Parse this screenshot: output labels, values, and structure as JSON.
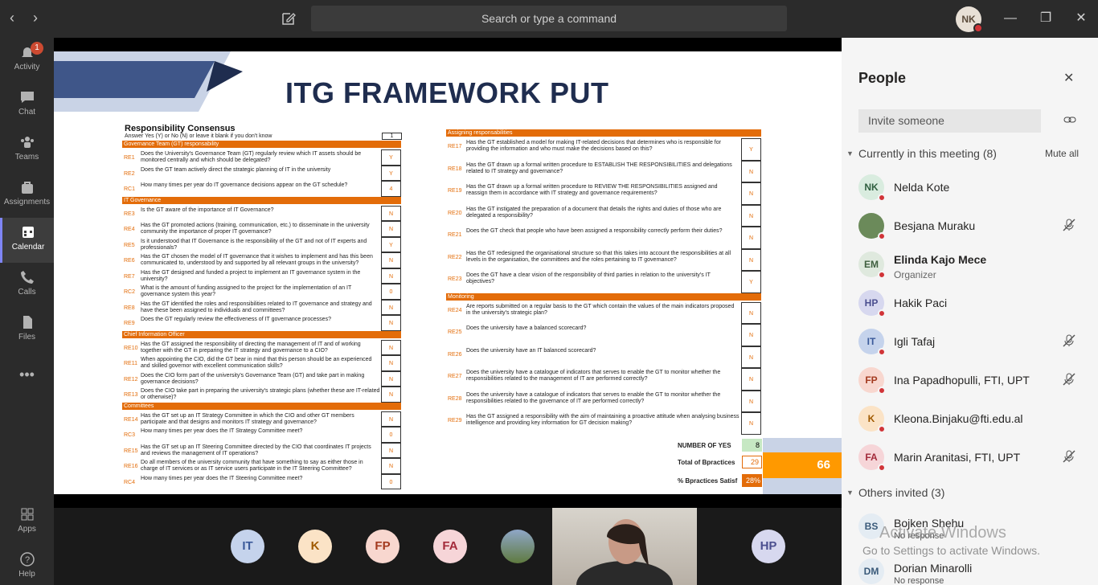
{
  "search": {
    "placeholder": "Search or type a command"
  },
  "me": {
    "initials": "NK"
  },
  "rail": [
    {
      "label": "Activity",
      "badge": "1"
    },
    {
      "label": "Chat"
    },
    {
      "label": "Teams"
    },
    {
      "label": "Assignments"
    },
    {
      "label": "Calendar"
    },
    {
      "label": "Calls"
    },
    {
      "label": "Files"
    },
    {
      "label": "Apps"
    },
    {
      "label": "Help"
    }
  ],
  "slide": {
    "title": "ITG FRAMEWORK PUT",
    "heading": "Responsibility Consensus",
    "instruction": "Answer Yes (Y) or No (N) or leave it blank if you don't know",
    "instruction_value": "1",
    "left_sections": [
      {
        "title": "Governance Team (GT) responsability",
        "items": [
          {
            "code": "RE1",
            "text": "Does the University's Governance Team (GT) regularly review which IT assets should be monitored centrally and which should be delegated?",
            "answer": "Y"
          },
          {
            "code": "RE2",
            "text": "Does the GT team actively direct the strategic planning of IT in the university",
            "answer": "Y"
          },
          {
            "code": "RC1",
            "text": "How many times per year do IT governance decisions appear on the GT schedule?",
            "answer": "4"
          }
        ]
      },
      {
        "title": "IT Governance",
        "items": [
          {
            "code": "RE3",
            "text": "Is the GT aware of the importance of IT Governance?",
            "answer": "N"
          },
          {
            "code": "RE4",
            "text": "Has the GT promoted actions (training, communication, etc.) to disseminate in the university community the importance of proper IT governance?",
            "answer": "N"
          },
          {
            "code": "RE5",
            "text": "Is it understood that IT Governance is the responsibility of the GT and not of IT experts and professionals?",
            "answer": "Y"
          },
          {
            "code": "RE6",
            "text": "Has the GT chosen the model of IT governance that it wishes to implement and has this been communicated to, understood by and supported by all relevant groups in the university?",
            "answer": "N"
          },
          {
            "code": "RE7",
            "text": "Has the GT designed and funded a project to implement an IT governance system in the university?",
            "answer": "N"
          },
          {
            "code": "RC2",
            "text": "What is the amount of funding assigned to the project for the implementation of an IT governance system this year?",
            "answer": "0"
          },
          {
            "code": "RE8",
            "text": "Has the GT identified the roles and responsibilities related to IT governance and strategy and have these been assigned to individuals and committees?",
            "answer": "N"
          },
          {
            "code": "RE9",
            "text": "Does the GT regularly review the effectiveness of IT governance processes?",
            "answer": "N"
          }
        ]
      },
      {
        "title": "Chief Information Officer",
        "items": [
          {
            "code": "RE10",
            "text": "Has the GT assigned the responsibility of directing the management of IT and of working together with the GT in preparing the IT strategy and governance to a CIO?",
            "answer": "N"
          },
          {
            "code": "RE11",
            "text": "When appointing the CIO, did the GT bear in mind that this person should be an experienced and skilled governor with excellent communication skills?",
            "answer": "N"
          },
          {
            "code": "RE12",
            "text": "Does the CIO form part of the university's Governance Team (GT) and take part in making governance decisions?",
            "answer": "N"
          },
          {
            "code": "RE13",
            "text": "Does the CIO take part in preparing the university's strategic plans (whether these are IT-related or otherwise)?",
            "answer": "N"
          }
        ]
      },
      {
        "title": "Committees",
        "items": [
          {
            "code": "RE14",
            "text": "Has the GT set up an IT Strategy Committee in which the CIO and other GT members participate and that designs and monitors IT strategy and governance?",
            "answer": "N"
          },
          {
            "code": "RC3",
            "text": "How many times per year does the IT Strategy Committee meet?",
            "answer": "0"
          },
          {
            "code": "RE15",
            "text": "Has the GT set up an IT Steering Committee directed by the CIO that coordinates IT projects and reviews the management of IT operations?",
            "answer": "N"
          },
          {
            "code": "RE16",
            "text": "Do all members of the university community that have something to say as either those in charge of IT services or as IT service users participate in the IT Steering Committee?",
            "answer": "N"
          },
          {
            "code": "RC4",
            "text": "How many times per year does the IT Steering Committee meet?",
            "answer": "0"
          }
        ]
      }
    ],
    "right_sections": [
      {
        "title": "Assigning responsabilities",
        "items": [
          {
            "code": "RE17",
            "text": "Has the GT established a model for making IT-related decisions that determines who is responsible for providing the information and who must make the decisions based on this?",
            "answer": "Y"
          },
          {
            "code": "RE18",
            "text": "Has the GT drawn up a formal written procedure to ESTABLISH THE RESPONSIBILITIES and delegations related to IT strategy and governance?",
            "answer": "N"
          },
          {
            "code": "RE19",
            "text": "Has the GT drawn up a formal written procedure to REVIEW THE RESPONSIBILITIES assigned and reassign them in accordance with IT strategy and governance requirements?",
            "answer": "N"
          },
          {
            "code": "RE20",
            "text": "Has the GT instigated the preparation of a document that details the rights and duties of those who are delegated a responsibility?",
            "answer": "N"
          },
          {
            "code": "RE21",
            "text": "Does the GT check that people who have been assigned a responsibility correctly perform their duties?",
            "answer": "N"
          },
          {
            "code": "RE22",
            "text": "Has the GT redesigned the organisational structure so that this takes into account the responsibilities at all levels in the organisation, the committees and the roles pertaining to IT governance?",
            "answer": "N"
          },
          {
            "code": "RE23",
            "text": "Does the GT have a clear vision of the responsibility of third parties in relation to the university's IT objectives?",
            "answer": "Y"
          }
        ]
      },
      {
        "title": "Monitoring",
        "items": [
          {
            "code": "RE24",
            "text": "Are reports submitted on a regular basis to the GT which contain the values of the main indicators proposed in the university's strategic plan?",
            "answer": "N"
          },
          {
            "code": "RE25",
            "text": "Does the university have a balanced scorecard?",
            "answer": "N"
          },
          {
            "code": "RE26",
            "text": "Does the university have an IT balanced scorecard?",
            "answer": "N"
          },
          {
            "code": "RE27",
            "text": "Does the university have a catalogue of indicators that serves to enable the GT to monitor whether the responsibilities related to the management of IT are performed correctly?",
            "answer": "N"
          },
          {
            "code": "RE28",
            "text": "Does the university have a catalogue of indicators that serves to enable the GT to monitor whether the responsibilities related to the governance of IT are performed correctly?",
            "answer": "N"
          },
          {
            "code": "RE29",
            "text": "Has the GT assigned a responsibility with the aim of maintaining a proactive attitude when analysing business intelligence and providing key information for GT decision making?",
            "answer": "N"
          }
        ]
      }
    ],
    "summary": {
      "yes_label": "NUMBER OF YES",
      "yes_value": "8",
      "total_label": "Total of Bpractices",
      "total_value": "29",
      "pct_label": "% Bpractices Satisf",
      "pct_value": "28%",
      "score": "66"
    }
  },
  "strip": [
    {
      "initials": "IT",
      "bg": "#c5d3ec",
      "fg": "#3b5a9a"
    },
    {
      "initials": "K",
      "bg": "#fbe3c6",
      "fg": "#a05a00"
    },
    {
      "initials": "FP",
      "bg": "#f8d7cf",
      "fg": "#a33a1f"
    },
    {
      "initials": "FA",
      "bg": "#f6d5d8",
      "fg": "#a32a3a"
    },
    {
      "initials": "HP",
      "bg": "#d7d8ef",
      "fg": "#4b4f8f"
    }
  ],
  "panel": {
    "title": "People",
    "invite_placeholder": "Invite someone",
    "current_header": "Currently in this meeting (8)",
    "mute_all": "Mute all",
    "others_header": "Others invited (3)",
    "people": [
      {
        "initials": "NK",
        "name": "Nelda Kote",
        "bg": "#d9ecdf",
        "fg": "#2f5f3f",
        "muted": false
      },
      {
        "initials": "",
        "name": "Besjana Muraku",
        "bg": "#6b8a5a",
        "fg": "#fff",
        "muted": true
      },
      {
        "initials": "EM",
        "name": "Elinda Kajo Mece",
        "role": "Organizer",
        "bg": "#dfe9de",
        "fg": "#3f5f3f",
        "muted": false
      },
      {
        "initials": "HP",
        "name": "Hakik Paci",
        "bg": "#d7d8ef",
        "fg": "#4b4f8f",
        "muted": false
      },
      {
        "initials": "IT",
        "name": "Igli Tafaj",
        "bg": "#c5d3ec",
        "fg": "#3b5a9a",
        "muted": true
      },
      {
        "initials": "FP",
        "name": "Ina Papadhopulli, FTI, UPT",
        "bg": "#f8d7cf",
        "fg": "#a33a1f",
        "muted": true
      },
      {
        "initials": "K",
        "name": "Kleona.Binjaku@fti.edu.al",
        "bg": "#fbe3c6",
        "fg": "#a05a00",
        "muted": false
      },
      {
        "initials": "FA",
        "name": "Marin Aranitasi, FTI, UPT",
        "bg": "#f6d5d8",
        "fg": "#a32a3a",
        "muted": true
      }
    ],
    "invited": [
      {
        "initials": "BS",
        "name": "Bojken Shehu",
        "status": "No response"
      },
      {
        "initials": "DM",
        "name": "Dorian Minarolli",
        "status": "No response"
      }
    ]
  },
  "watermark": {
    "line1": "Activate Windows",
    "line2": "Go to Settings to activate Windows."
  }
}
